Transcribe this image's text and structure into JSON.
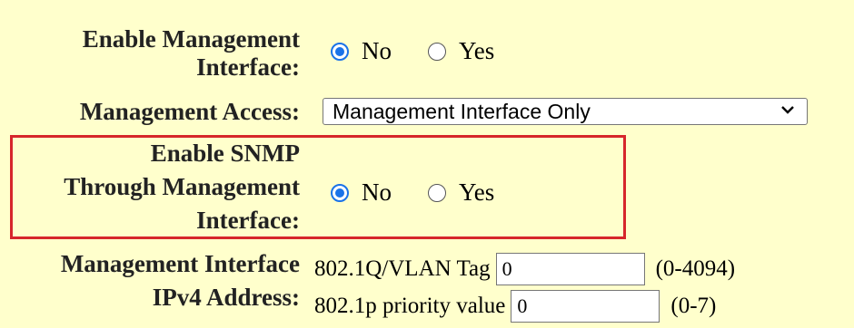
{
  "enable_mgmt": {
    "label_line1": "Enable Management",
    "label_line2": "Interface:",
    "option_no": "No",
    "option_yes": "Yes",
    "selected": "No"
  },
  "mgmt_access": {
    "label": "Management Access:",
    "selected_value": "Management Interface Only"
  },
  "enable_snmp": {
    "label_line1": "Enable SNMP",
    "label_line2": "Through Management",
    "label_line3": "Interface:",
    "option_no": "No",
    "option_yes": "Yes",
    "selected": "No",
    "highlight_color": "#d6262b"
  },
  "ipv4": {
    "label_line1": "Management Interface",
    "label_line2": "IPv4 Address:",
    "vlan_label": "802.1Q/VLAN Tag",
    "vlan_value": "0",
    "vlan_range": "(0-4094)",
    "priority_label": "802.1p priority value",
    "priority_value": "0",
    "priority_range": "(0-7)"
  },
  "colors": {
    "background": "#ffffcc",
    "radio_accent": "#1a73e8"
  }
}
